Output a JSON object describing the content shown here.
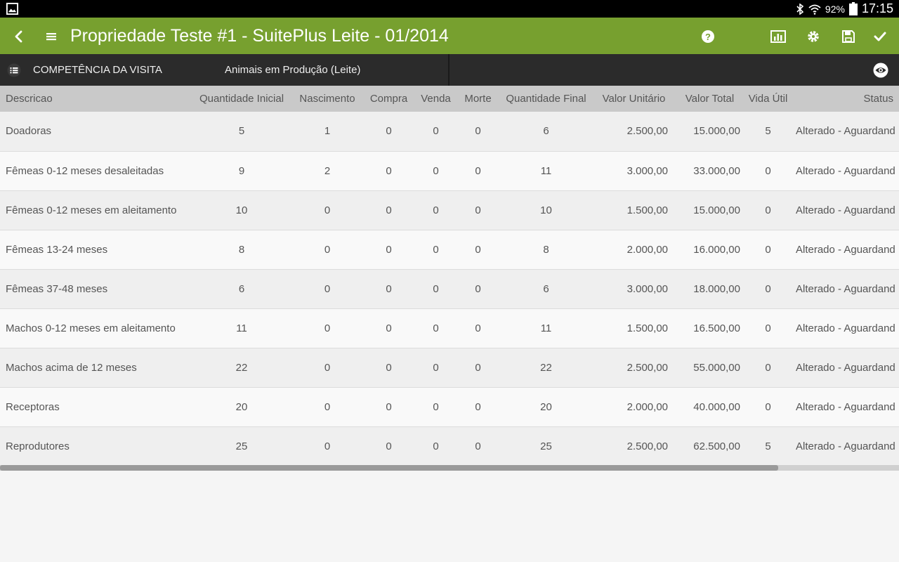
{
  "status_bar": {
    "battery_percent": "92%",
    "time": "17:15"
  },
  "app_bar": {
    "title": "Propriedade Teste #1 - SuitePlus Leite - 01/2014",
    "color": "#77a02f"
  },
  "sub_bar": {
    "section_label": "COMPETÊNCIA DA VISITA",
    "selected_category": "Animais em Produção (Leite)"
  },
  "table": {
    "headers": {
      "descricao": "Descricao",
      "quantidade_inicial": "Quantidade Inicial",
      "nascimento": "Nascimento",
      "compra": "Compra",
      "venda": "Venda",
      "morte": "Morte",
      "quantidade_final": "Quantidade Final",
      "valor_unitario": "Valor Unitário",
      "valor_total": "Valor Total",
      "vida_util": "Vida Útil",
      "status": "Status"
    },
    "rows": [
      {
        "descricao": "Doadoras",
        "quantidade_inicial": "5",
        "nascimento": "1",
        "compra": "0",
        "venda": "0",
        "morte": "0",
        "quantidade_final": "6",
        "valor_unitario": "2.500,00",
        "valor_total": "15.000,00",
        "vida_util": "5",
        "status": "Alterado - Aguardand"
      },
      {
        "descricao": "Fêmeas 0-12 meses desaleitadas",
        "quantidade_inicial": "9",
        "nascimento": "2",
        "compra": "0",
        "venda": "0",
        "morte": "0",
        "quantidade_final": "11",
        "valor_unitario": "3.000,00",
        "valor_total": "33.000,00",
        "vida_util": "0",
        "status": "Alterado - Aguardand"
      },
      {
        "descricao": "Fêmeas 0-12 meses em aleitamento",
        "quantidade_inicial": "10",
        "nascimento": "0",
        "compra": "0",
        "venda": "0",
        "morte": "0",
        "quantidade_final": "10",
        "valor_unitario": "1.500,00",
        "valor_total": "15.000,00",
        "vida_util": "0",
        "status": "Alterado - Aguardand"
      },
      {
        "descricao": "Fêmeas 13-24 meses",
        "quantidade_inicial": "8",
        "nascimento": "0",
        "compra": "0",
        "venda": "0",
        "morte": "0",
        "quantidade_final": "8",
        "valor_unitario": "2.000,00",
        "valor_total": "16.000,00",
        "vida_util": "0",
        "status": "Alterado - Aguardand"
      },
      {
        "descricao": "Fêmeas 37-48 meses",
        "quantidade_inicial": "6",
        "nascimento": "0",
        "compra": "0",
        "venda": "0",
        "morte": "0",
        "quantidade_final": "6",
        "valor_unitario": "3.000,00",
        "valor_total": "18.000,00",
        "vida_util": "0",
        "status": "Alterado - Aguardand"
      },
      {
        "descricao": "Machos 0-12 meses em aleitamento",
        "quantidade_inicial": "11",
        "nascimento": "0",
        "compra": "0",
        "venda": "0",
        "morte": "0",
        "quantidade_final": "11",
        "valor_unitario": "1.500,00",
        "valor_total": "16.500,00",
        "vida_util": "0",
        "status": "Alterado - Aguardand"
      },
      {
        "descricao": "Machos acima de 12 meses",
        "quantidade_inicial": "22",
        "nascimento": "0",
        "compra": "0",
        "venda": "0",
        "morte": "0",
        "quantidade_final": "22",
        "valor_unitario": "2.500,00",
        "valor_total": "55.000,00",
        "vida_util": "0",
        "status": "Alterado - Aguardand"
      },
      {
        "descricao": "Receptoras",
        "quantidade_inicial": "20",
        "nascimento": "0",
        "compra": "0",
        "venda": "0",
        "morte": "0",
        "quantidade_final": "20",
        "valor_unitario": "2.000,00",
        "valor_total": "40.000,00",
        "vida_util": "0",
        "status": "Alterado - Aguardand"
      },
      {
        "descricao": "Reprodutores",
        "quantidade_inicial": "25",
        "nascimento": "0",
        "compra": "0",
        "venda": "0",
        "morte": "0",
        "quantidade_final": "25",
        "valor_unitario": "2.500,00",
        "valor_total": "62.500,00",
        "vida_util": "5",
        "status": "Alterado - Aguardand"
      }
    ]
  },
  "horizontal_scroll": {
    "thumb_fraction": 0.866
  }
}
